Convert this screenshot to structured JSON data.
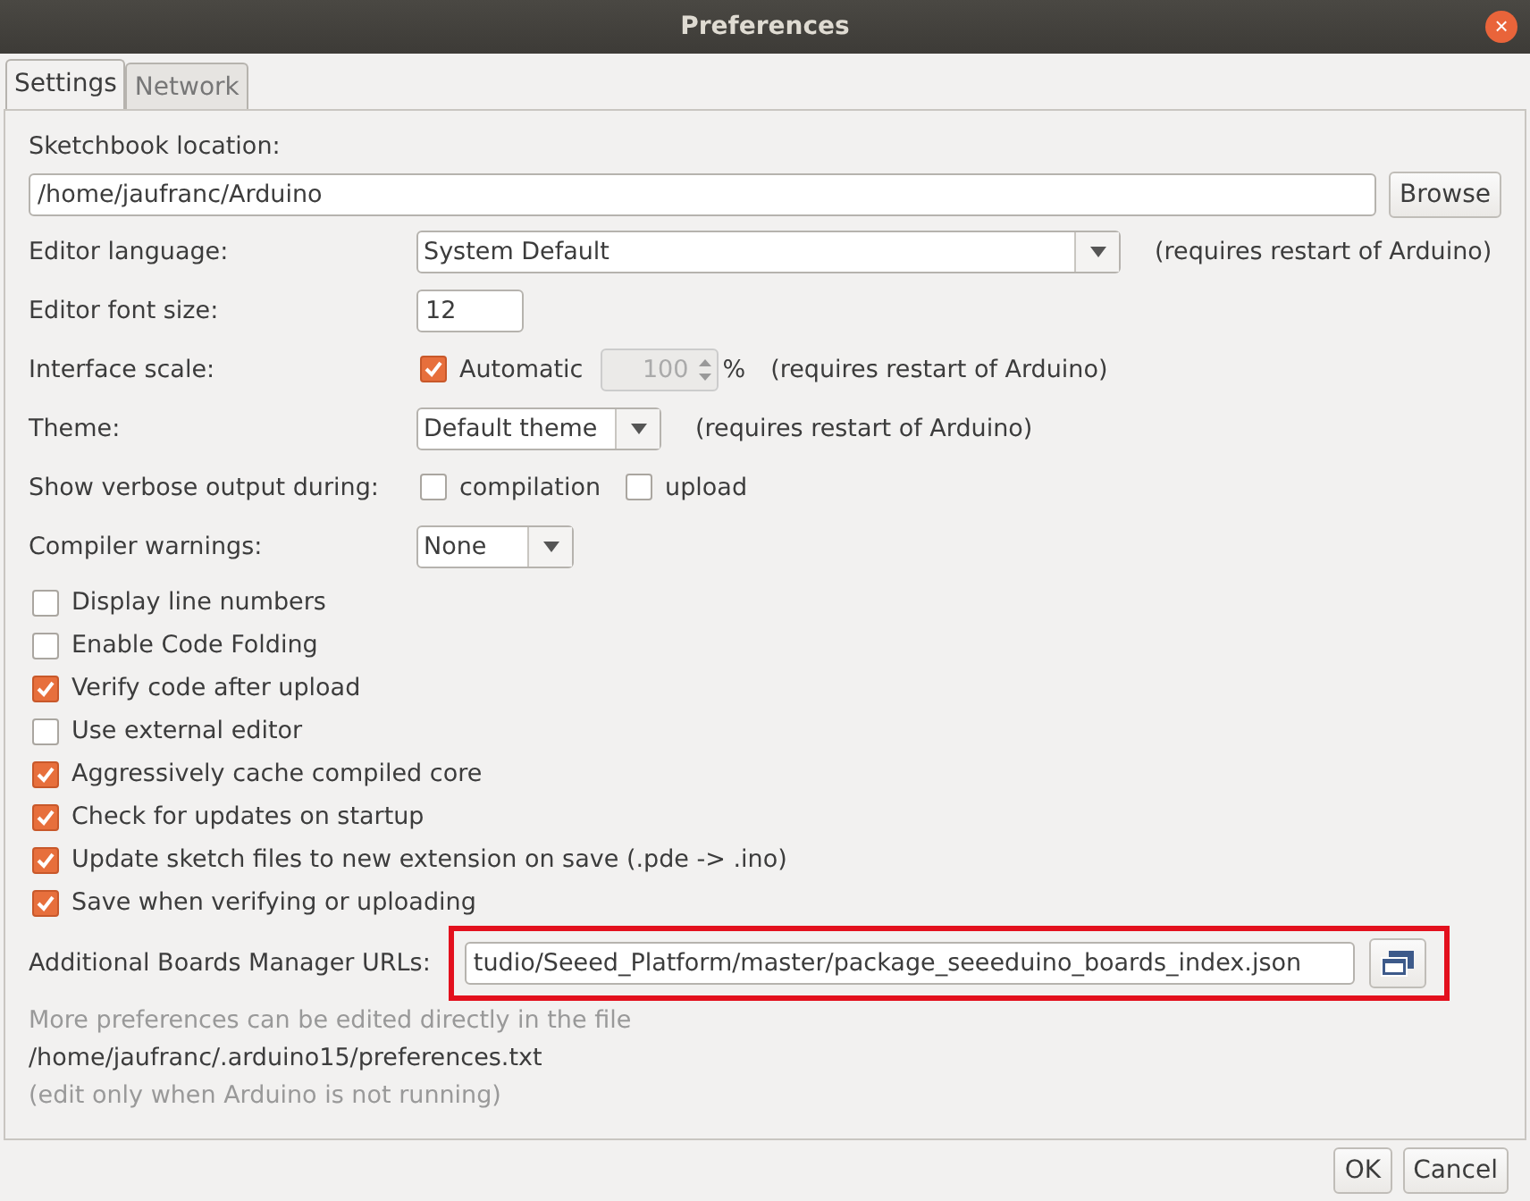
{
  "window": {
    "title": "Preferences",
    "close": "×"
  },
  "tabs": [
    {
      "label": "Settings",
      "selected": true
    },
    {
      "label": "Network",
      "selected": false
    }
  ],
  "sketchbook": {
    "label": "Sketchbook location:",
    "value": "/home/jaufranc/Arduino",
    "button": "Browse"
  },
  "editor_language": {
    "label": "Editor language:",
    "value": "System Default",
    "note": "(requires restart of Arduino)"
  },
  "font_size": {
    "label": "Editor font size:",
    "value": "12"
  },
  "interface_scale": {
    "label": "Interface scale:",
    "automatic": {
      "label": "Automatic",
      "checked": true
    },
    "value": "100",
    "unit": "%",
    "note": "(requires restart of Arduino)"
  },
  "theme": {
    "label": "Theme:",
    "value": "Default theme",
    "note": "(requires restart of Arduino)"
  },
  "verbose": {
    "label": "Show verbose output during:",
    "options": [
      {
        "label": "compilation",
        "checked": false
      },
      {
        "label": "upload",
        "checked": false
      }
    ]
  },
  "compiler_warnings": {
    "label": "Compiler warnings:",
    "value": "None"
  },
  "options": [
    {
      "label": "Display line numbers",
      "checked": false
    },
    {
      "label": "Enable Code Folding",
      "checked": false
    },
    {
      "label": "Verify code after upload",
      "checked": true
    },
    {
      "label": "Use external editor",
      "checked": false
    },
    {
      "label": "Aggressively cache compiled core",
      "checked": true
    },
    {
      "label": "Check for updates on startup",
      "checked": true
    },
    {
      "label": "Update sketch files to new extension on save (.pde -> .ino)",
      "checked": true
    },
    {
      "label": "Save when verifying or uploading",
      "checked": true
    }
  ],
  "boards_urls": {
    "label": "Additional Boards Manager URLs:",
    "value": "tudio/Seeed_Platform/master/package_seeeduino_boards_index.json",
    "highlighted": true
  },
  "notes": [
    {
      "kind": "hint",
      "text": "More preferences can be edited directly in the file"
    },
    {
      "kind": "path",
      "text": "/home/jaufranc/.arduino15/preferences.txt"
    },
    {
      "kind": "hint",
      "text": "(edit only when Arduino is not running)"
    }
  ],
  "buttons": [
    "OK",
    "Cancel"
  ]
}
